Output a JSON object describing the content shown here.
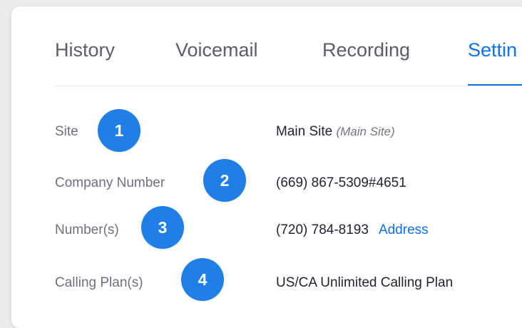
{
  "tabs": [
    {
      "label": "History"
    },
    {
      "label": "Voicemail"
    },
    {
      "label": "Recording"
    },
    {
      "label": "Settin"
    }
  ],
  "active_tab": "Settings",
  "rows": [
    {
      "label": "Site",
      "value": "Main Site",
      "note": "(Main Site)",
      "badge": "1"
    },
    {
      "label": "Company Number",
      "value": "(669) 867-5309#4651",
      "badge": "2"
    },
    {
      "label": "Number(s)",
      "value": "(720) 784-8193",
      "link": "Address",
      "badge": "3"
    },
    {
      "label": "Calling Plan(s)",
      "value": "US/CA Unlimited Calling Plan",
      "badge": "4"
    }
  ],
  "colors": {
    "accent": "#0e72ed",
    "badge": "#1f7fe6",
    "label": "#6e7080",
    "value": "#232333"
  }
}
